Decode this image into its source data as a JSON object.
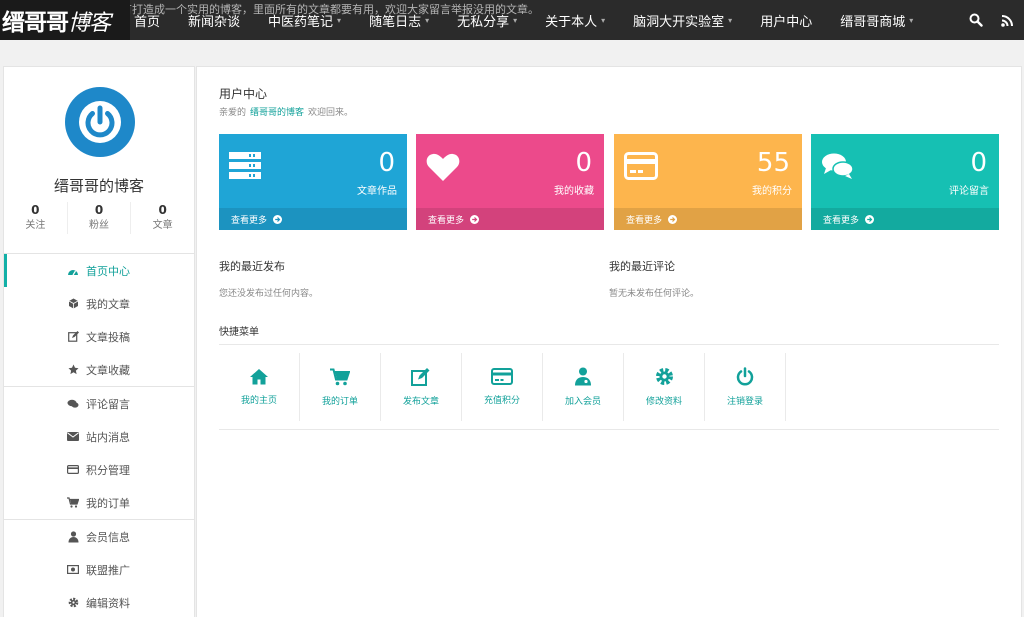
{
  "header": {
    "ticker": "…有打造成一个实用的博客，里面所有的文章都要有用，欢迎大家留言举报没用的文章。",
    "logo_main": "缙哥哥",
    "logo_script": "博客",
    "nav": [
      {
        "label": "首页",
        "dropdown": false
      },
      {
        "label": "新闻杂谈",
        "dropdown": false
      },
      {
        "label": "中医药笔记",
        "dropdown": true
      },
      {
        "label": "随笔日志",
        "dropdown": true
      },
      {
        "label": "无私分享",
        "dropdown": true
      },
      {
        "label": "关于本人",
        "dropdown": true
      },
      {
        "label": "脑洞大开实验室",
        "dropdown": true
      },
      {
        "label": "用户中心",
        "dropdown": false
      },
      {
        "label": "缙哥哥商城",
        "dropdown": true
      }
    ],
    "caret": "▾"
  },
  "sidebar": {
    "username": "缙哥哥的博客",
    "stats": [
      {
        "value": "0",
        "label": "关注"
      },
      {
        "value": "0",
        "label": "粉丝"
      },
      {
        "value": "0",
        "label": "文章"
      }
    ],
    "menu": [
      {
        "label": "首页中心",
        "icon": "dashboard-icon",
        "active": true
      },
      {
        "label": "我的文章",
        "icon": "cube-icon"
      },
      {
        "label": "文章投稿",
        "icon": "edit-icon"
      },
      {
        "label": "文章收藏",
        "icon": "star-icon"
      },
      {
        "label": "评论留言",
        "icon": "comments-icon"
      },
      {
        "label": "站内消息",
        "icon": "envelope-icon"
      },
      {
        "label": "积分管理",
        "icon": "credit-card-icon"
      },
      {
        "label": "我的订单",
        "icon": "cart-icon"
      },
      {
        "label": "会员信息",
        "icon": "user-md-icon"
      },
      {
        "label": "联盟推广",
        "icon": "money-icon"
      },
      {
        "label": "编辑资料",
        "icon": "gear-icon"
      }
    ]
  },
  "main": {
    "title": "用户中心",
    "welcome_prefix": "亲爱的",
    "welcome_name": "缙哥哥的博客",
    "welcome_suffix": "欢迎回来。",
    "cards": [
      {
        "value": "0",
        "label": "文章作品",
        "more": "查看更多",
        "color": "#1fa5d6",
        "footer_color": "#1c93c0",
        "icon": "server-icon"
      },
      {
        "value": "0",
        "label": "我的收藏",
        "more": "查看更多",
        "color": "#ec4a8b",
        "footer_color": "#d3427c",
        "icon": "heart-icon"
      },
      {
        "value": "55",
        "label": "我的积分",
        "more": "查看更多",
        "color": "#fdb54d",
        "footer_color": "#e1a245",
        "icon": "credit-card-icon"
      },
      {
        "value": "0",
        "label": "评论留言",
        "more": "查看更多",
        "color": "#16c0b3",
        "footer_color": "#13aa9f",
        "icon": "comments-icon"
      }
    ],
    "recent_posts": {
      "title": "我的最近发布",
      "empty": "您还没发布过任何内容。"
    },
    "recent_comments": {
      "title": "我的最近评论",
      "empty": "暂无未发布任何评论。"
    },
    "quick_title": "快捷菜单",
    "quick": [
      {
        "label": "我的主页",
        "icon": "home-icon"
      },
      {
        "label": "我的订单",
        "icon": "cart-icon"
      },
      {
        "label": "发布文章",
        "icon": "edit-icon"
      },
      {
        "label": "充值积分",
        "icon": "credit-card-icon"
      },
      {
        "label": "加入会员",
        "icon": "user-md-icon"
      },
      {
        "label": "修改资料",
        "icon": "gear-icon"
      },
      {
        "label": "注销登录",
        "icon": "power-icon"
      }
    ]
  },
  "colors": {
    "accent": "#12a19a",
    "nav_bg": "#2b2b2b",
    "avatar": "#1e88c9"
  }
}
